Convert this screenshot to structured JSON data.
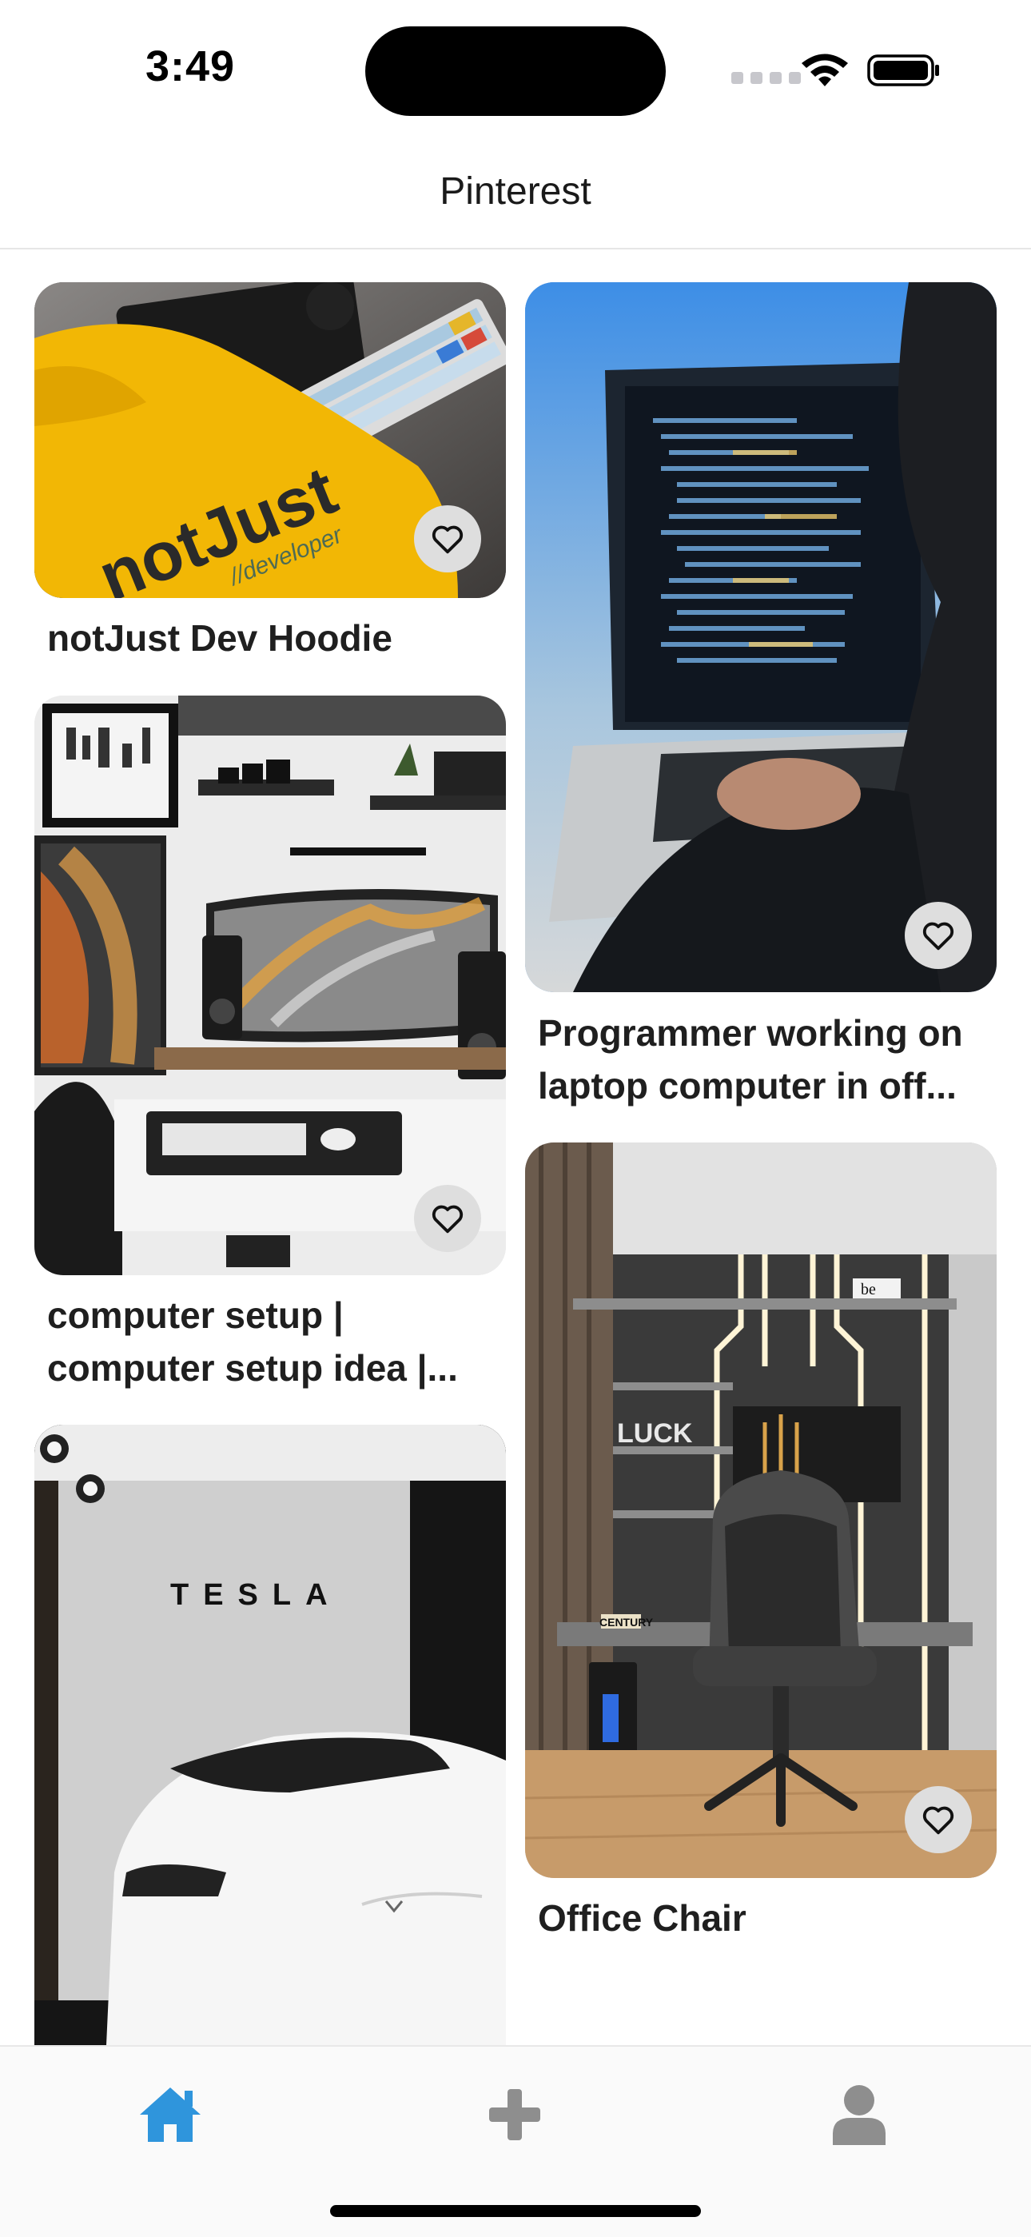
{
  "status_bar": {
    "time": "3:49"
  },
  "header": {
    "title": "Pinterest"
  },
  "pins": [
    {
      "title": "notJust Dev Hoodie",
      "image": "yellow notJust developer hoodie beside keyboard",
      "hoodie_text": "notJust",
      "hoodie_subtext": "//developer"
    },
    {
      "title": "Programmer working on\nlaptop computer in off...",
      "image": "person typing code on laptop"
    },
    {
      "title": "computer setup |\ncomputer setup idea |...",
      "image": "desk with curved monitor and speakers"
    },
    {
      "title": "Office Chair",
      "image": "modern office with gaming chair",
      "shelf_text": "LUCK",
      "book_text": "be",
      "book2_text": "CENTURY"
    },
    {
      "title": "",
      "image": "white Tesla roadster in showroom",
      "wall_text": "TESLA"
    }
  ],
  "tabbar": {
    "items": [
      {
        "name": "home",
        "icon": "home-icon",
        "active": true
      },
      {
        "name": "create",
        "icon": "plus-icon",
        "active": false
      },
      {
        "name": "profile",
        "icon": "user-icon",
        "active": false
      }
    ],
    "active_color": "#2f95dc",
    "inactive_color": "#8e8e8e"
  }
}
